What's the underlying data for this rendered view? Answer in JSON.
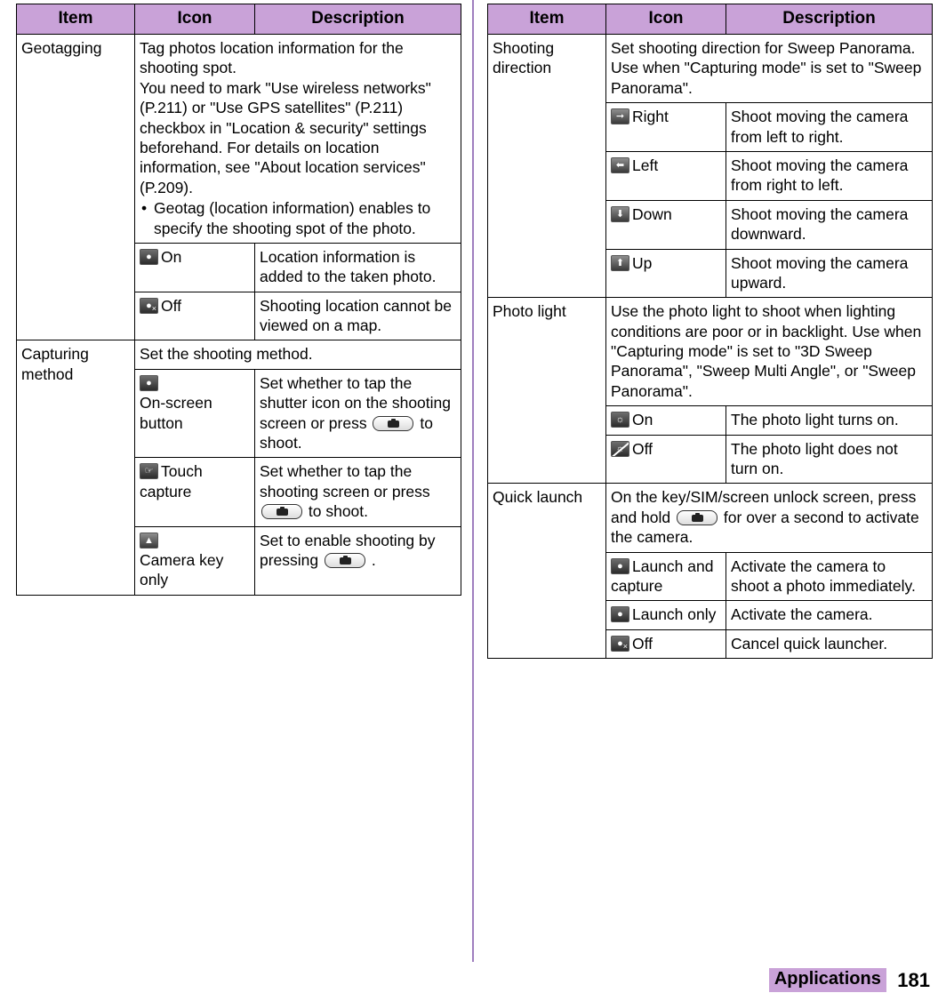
{
  "headers": {
    "item": "Item",
    "icon": "Icon",
    "description": "Description"
  },
  "left_table": {
    "geotagging": {
      "item": "Geotagging",
      "description_lines": [
        "Tag photos location information for the shooting spot.",
        "You need to mark \"Use wireless networks\" (P.211) or \"Use GPS satellites\" (P.211) checkbox in \"Location & security\" settings beforehand. For details on location information, see \"About location services\" (P.209)."
      ],
      "bullets": [
        "Geotag (location information) enables to specify the shooting spot of the photo."
      ],
      "rows": [
        {
          "icon": "location-on-icon",
          "icon_label": "On",
          "description": "Location information is added to the taken photo."
        },
        {
          "icon": "location-off-icon",
          "icon_label": "Off",
          "description": "Shooting location cannot be viewed on a map."
        }
      ]
    },
    "capturing_method": {
      "item": "Capturing method",
      "description": "Set the shooting method.",
      "rows": [
        {
          "icon": "on-screen-button-icon",
          "icon_label": "On-screen button",
          "description_pre": "Set whether to tap the shutter icon on the shooting screen or press",
          "description_post": "to shoot."
        },
        {
          "icon": "touch-capture-icon",
          "icon_label": "Touch capture",
          "description_pre": "Set whether to tap the shooting screen or press",
          "description_post": "to shoot."
        },
        {
          "icon": "camera-key-only-icon",
          "icon_label": "Camera key only",
          "description_pre": "Set to enable shooting by pressing",
          "description_post": "."
        }
      ]
    }
  },
  "right_table": {
    "shooting_direction": {
      "item": "Shooting direction",
      "description": "Set shooting direction for Sweep Panorama. Use when \"Capturing mode\" is set to \"Sweep Panorama\".",
      "rows": [
        {
          "icon": "arrow-right-icon",
          "icon_label": "Right",
          "description": "Shoot moving the camera from left to right."
        },
        {
          "icon": "arrow-left-icon",
          "icon_label": "Left",
          "description": "Shoot moving the camera from right to left."
        },
        {
          "icon": "arrow-down-icon",
          "icon_label": "Down",
          "description": "Shoot moving the camera downward."
        },
        {
          "icon": "arrow-up-icon",
          "icon_label": "Up",
          "description": "Shoot moving the camera upward."
        }
      ]
    },
    "photo_light": {
      "item": "Photo light",
      "description": "Use the photo light to shoot when lighting conditions are poor or in backlight. Use when \"Capturing mode\" is set to \"3D Sweep Panorama\", \"Sweep Multi Angle\", or \"Sweep Panorama\".",
      "rows": [
        {
          "icon": "photo-light-on-icon",
          "icon_label": "On",
          "description": "The photo light turns on."
        },
        {
          "icon": "photo-light-off-icon",
          "icon_label": "Off",
          "description": "The photo light does not turn on."
        }
      ]
    },
    "quick_launch": {
      "item": "Quick launch",
      "description_pre": "On the key/SIM/screen unlock screen, press and hold",
      "description_post": "for over a second to activate the camera.",
      "rows": [
        {
          "icon": "launch-and-capture-icon",
          "icon_label": "Launch and capture",
          "description": "Activate the camera to shoot a photo immediately."
        },
        {
          "icon": "launch-only-icon",
          "icon_label": "Launch only",
          "description": "Activate the camera."
        },
        {
          "icon": "quick-launch-off-icon",
          "icon_label": "Off",
          "description": "Cancel quick launcher."
        }
      ]
    }
  },
  "footer": {
    "section": "Applications",
    "page": "181"
  }
}
